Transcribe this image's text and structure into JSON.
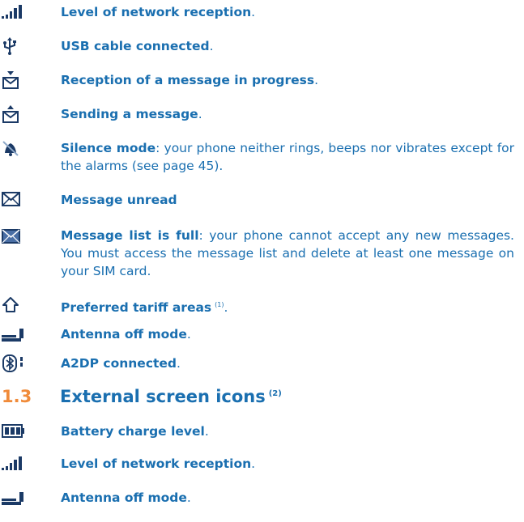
{
  "items": [
    {
      "icon": "network-signal-icon",
      "bold": "Level of network reception",
      "rest": "."
    },
    {
      "icon": "usb-icon",
      "bold": "USB cable connected",
      "rest": "."
    },
    {
      "icon": "message-receiving-icon",
      "bold": "Reception of a message in progress",
      "rest": "."
    },
    {
      "icon": "message-sending-icon",
      "bold": "Sending a message",
      "rest": "."
    },
    {
      "icon": "silence-bell-icon",
      "bold": "Silence mode",
      "rest": ": your phone neither rings, beeps nor vibrates except for the alarms (see page 45)."
    },
    {
      "icon": "envelope-outline-icon",
      "bold": "Message unread",
      "rest": ""
    },
    {
      "icon": "envelope-filled-icon",
      "bold": "Message list is full",
      "rest": ": your phone cannot accept any new messages. You must access the message list and delete at least one message on your SIM card."
    },
    {
      "icon": "home-arrow-icon",
      "bold": "Preferred tariff areas",
      "sup": "(1)",
      "rest": "."
    },
    {
      "icon": "antenna-off-icon",
      "bold": "Antenna off mode",
      "rest": "."
    },
    {
      "icon": "bluetooth-a2dp-icon",
      "bold": "A2DP connected",
      "rest": "."
    }
  ],
  "section": {
    "number": "1.3",
    "title": "External screen icons",
    "sup": "(2)"
  },
  "external_items": [
    {
      "icon": "battery-icon",
      "bold": "Battery charge level",
      "rest": "."
    },
    {
      "icon": "network-signal-icon",
      "bold": "Level of network reception",
      "rest": "."
    },
    {
      "icon": "antenna-off-icon",
      "bold": "Antenna off mode",
      "rest": "."
    }
  ],
  "colors": {
    "text": "#1a6fb0",
    "heading_number": "#f08b3a",
    "icon": "#1b3a66"
  }
}
